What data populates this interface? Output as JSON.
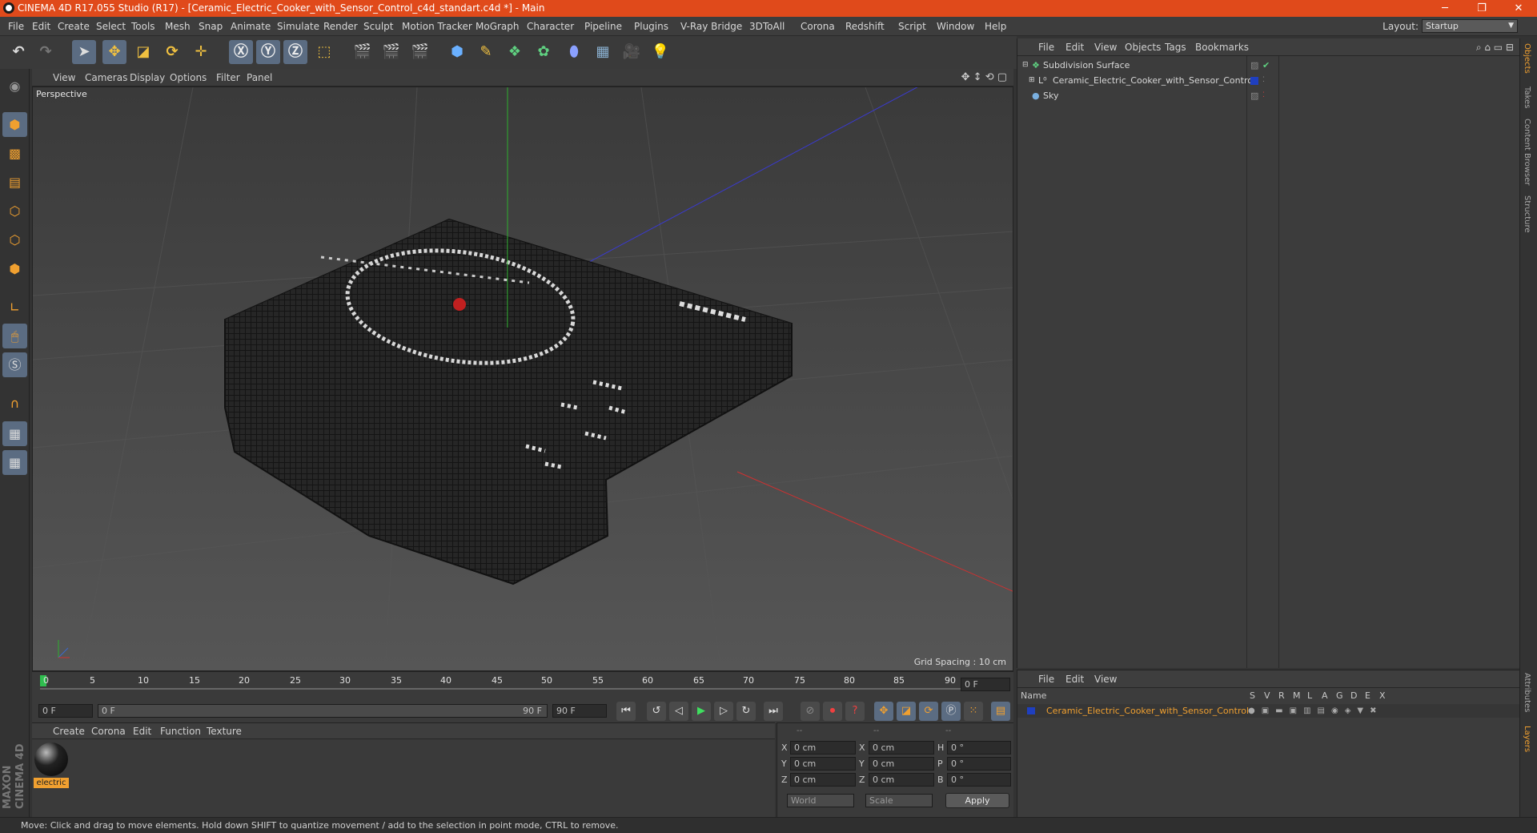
{
  "window": {
    "title": "CINEMA 4D R17.055 Studio (R17) - [Ceramic_Electric_Cooker_with_Sensor_Control_c4d_standart.c4d *] - Main"
  },
  "menubar": {
    "items": [
      "File",
      "Edit",
      "Create",
      "Select",
      "Tools",
      "Mesh",
      "Snap",
      "Animate",
      "Simulate",
      "Render",
      "Sculpt",
      "Motion Tracker",
      "MoGraph",
      "Character",
      "Pipeline",
      "Plugins",
      "V-Ray Bridge",
      "3DToAll",
      "Corona",
      "Redshift",
      "Script",
      "Window",
      "Help"
    ],
    "layout_label": "Layout:",
    "layout_value": "Startup"
  },
  "viewport": {
    "menu": [
      "View",
      "Cameras",
      "Display",
      "Options",
      "Filter",
      "Panel"
    ],
    "label": "Perspective",
    "grid_spacing": "Grid Spacing : 10 cm"
  },
  "timeline": {
    "ticks": [
      "0",
      "5",
      "10",
      "15",
      "20",
      "25",
      "30",
      "35",
      "40",
      "45",
      "50",
      "55",
      "60",
      "65",
      "70",
      "75",
      "80",
      "85",
      "90"
    ],
    "current_frame": "0 F",
    "start_field": "0 F",
    "slider_start": "0 F",
    "slider_end": "90 F",
    "end_field": "90 F"
  },
  "material_manager": {
    "menu": [
      "Create",
      "Corona",
      "Edit",
      "Function",
      "Texture"
    ],
    "materials": [
      {
        "name": "electric"
      }
    ]
  },
  "coordinates": {
    "header": [
      "--",
      "--",
      "--"
    ],
    "rows": [
      {
        "a": "X",
        "av": "0 cm",
        "b": "X",
        "bv": "0 cm",
        "c": "H",
        "cv": "0 °"
      },
      {
        "a": "Y",
        "av": "0 cm",
        "b": "Y",
        "bv": "0 cm",
        "c": "P",
        "cv": "0 °"
      },
      {
        "a": "Z",
        "av": "0 cm",
        "b": "Z",
        "bv": "0 cm",
        "c": "B",
        "cv": "0 °"
      }
    ],
    "mode": "World",
    "scale": "Scale",
    "apply": "Apply"
  },
  "object_manager": {
    "menu": [
      "File",
      "Edit",
      "View",
      "Objects",
      "Tags",
      "Bookmarks"
    ],
    "objects": [
      {
        "name": "Subdivision Surface"
      },
      {
        "name": "Ceramic_Electric_Cooker_with_Sensor_Control"
      },
      {
        "name": "Sky"
      }
    ]
  },
  "layer_manager": {
    "menu": [
      "File",
      "Edit",
      "View"
    ],
    "col_name": "Name",
    "cols": [
      "S",
      "V",
      "R",
      "M",
      "L",
      "A",
      "G",
      "D",
      "E",
      "X"
    ],
    "layer": "Ceramic_Electric_Cooker_with_Sensor_Control"
  },
  "right_tabs": [
    "Objects",
    "Takes",
    "Content Browser",
    "Structure",
    "Attributes",
    "Layers"
  ],
  "status": "Move: Click and drag to move elements. Hold down SHIFT to quantize movement / add to the selection in point mode, CTRL to remove.",
  "brand": "MAXON CINEMA 4D",
  "colors": {
    "title_bar": "#e04a1b",
    "accent_orange": "#f0a030",
    "layer_blue": "#1f3fbf"
  }
}
